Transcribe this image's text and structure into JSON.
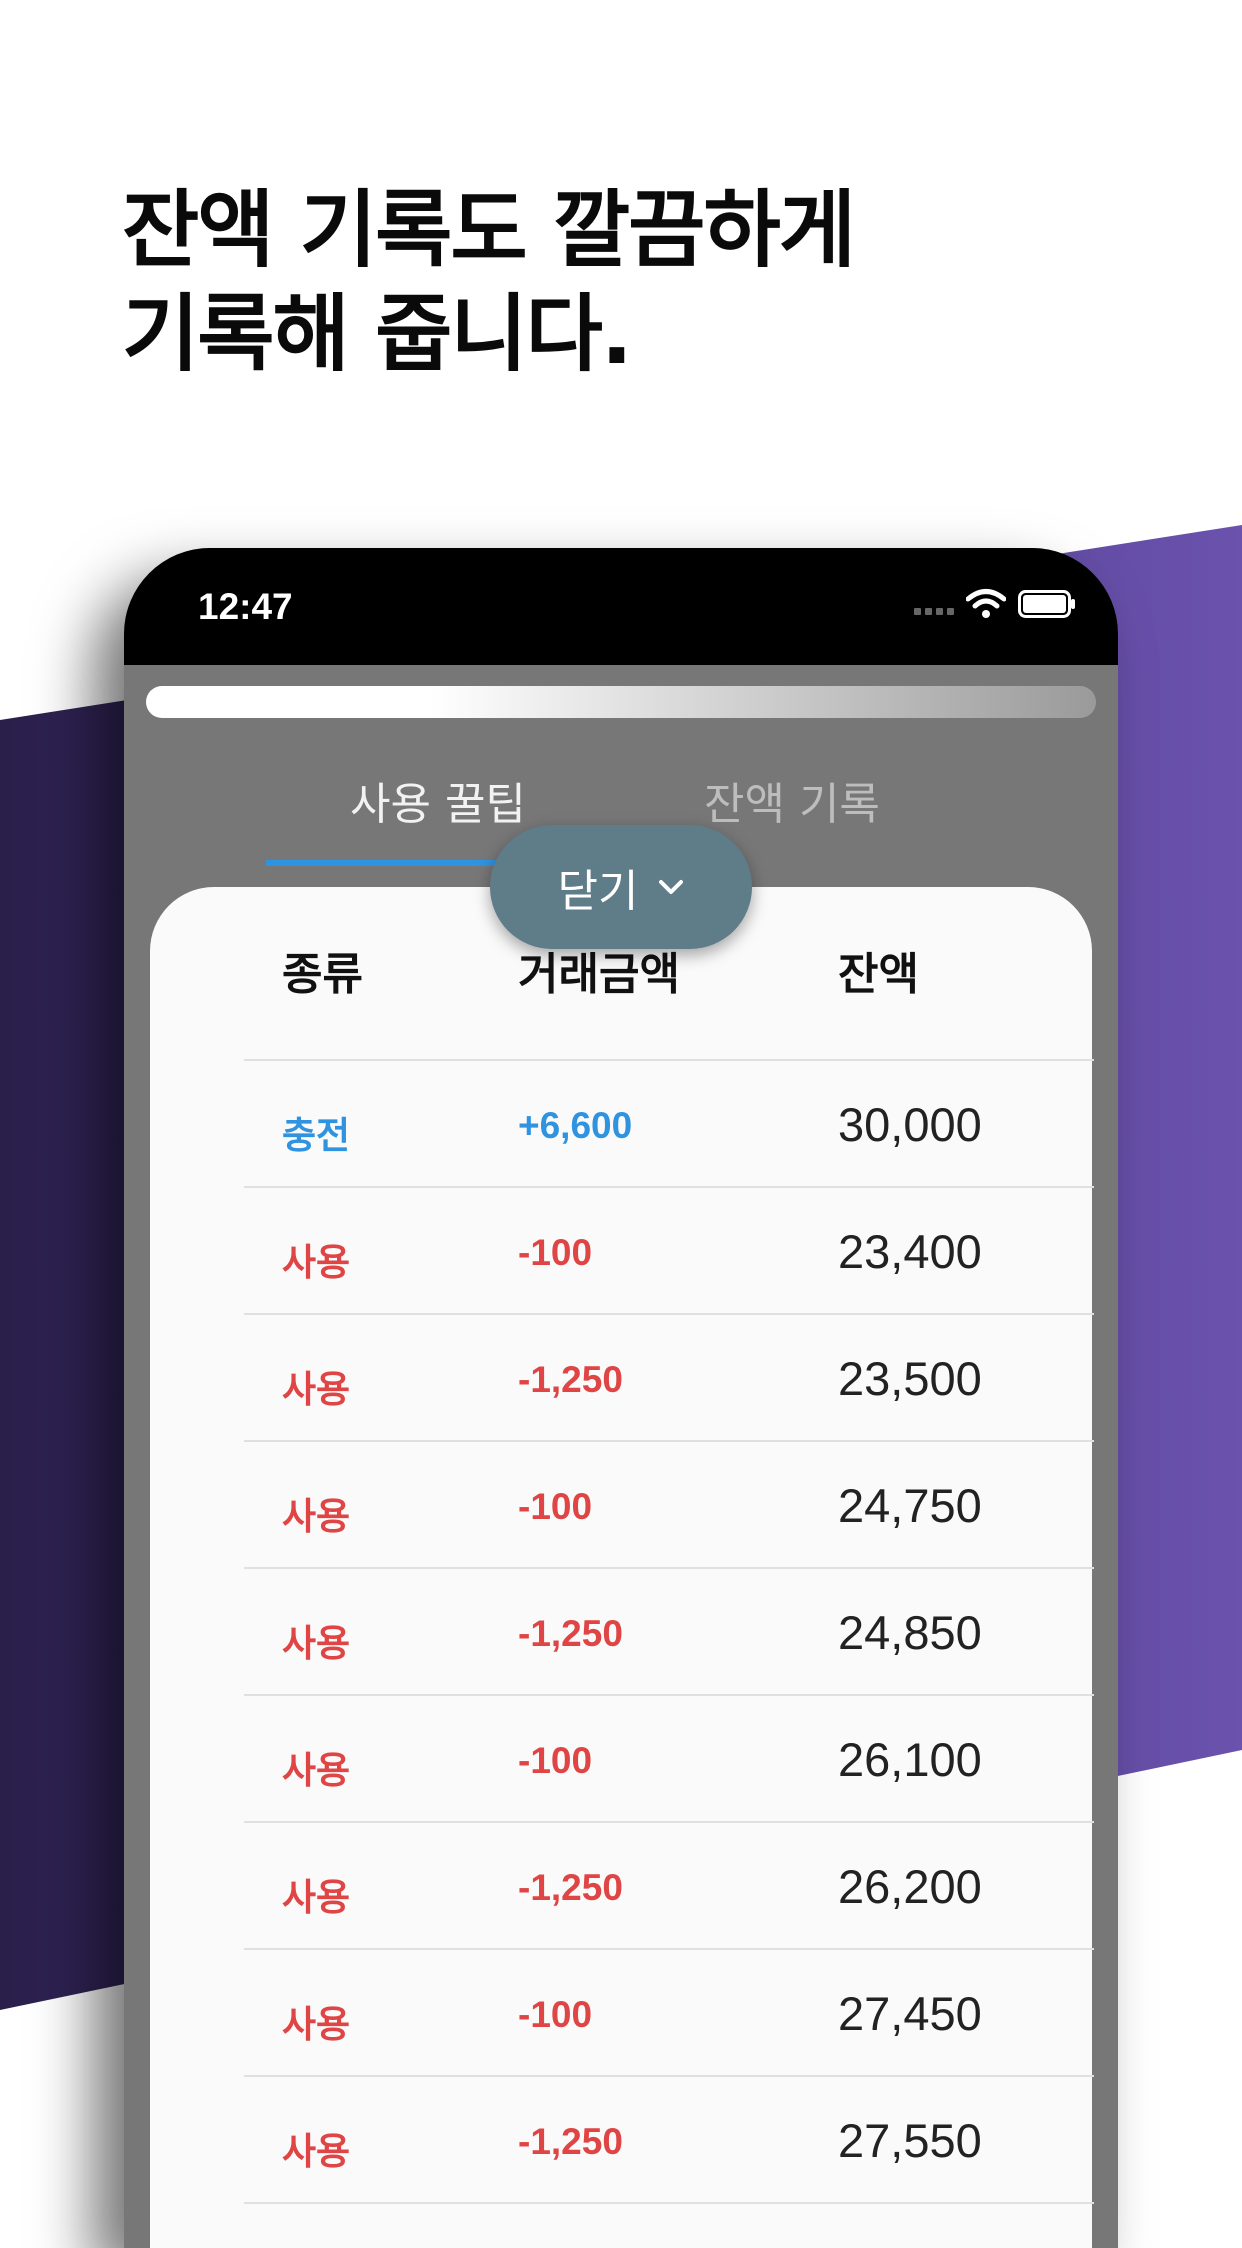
{
  "headline": {
    "line1": "잔액 기록도 깔끔하게",
    "line2": "기록해 줍니다."
  },
  "status_bar": {
    "time": "12:47",
    "icons": [
      "signal-icon",
      "wifi-icon",
      "battery-icon"
    ]
  },
  "tabs": [
    {
      "label": "사용 꿀팁",
      "active": true
    },
    {
      "label": "잔액 기록",
      "active": false
    }
  ],
  "close_button": {
    "label": "닫기",
    "icon": "chevron-down-icon"
  },
  "table": {
    "headers": [
      "종류",
      "거래금액",
      "잔액"
    ],
    "rows": [
      {
        "type": "충전",
        "amount": "+6,600",
        "balance": "30,000",
        "kind": "charge"
      },
      {
        "type": "사용",
        "amount": "-100",
        "balance": "23,400",
        "kind": "use"
      },
      {
        "type": "사용",
        "amount": "-1,250",
        "balance": "23,500",
        "kind": "use"
      },
      {
        "type": "사용",
        "amount": "-100",
        "balance": "24,750",
        "kind": "use"
      },
      {
        "type": "사용",
        "amount": "-1,250",
        "balance": "24,850",
        "kind": "use"
      },
      {
        "type": "사용",
        "amount": "-100",
        "balance": "26,100",
        "kind": "use"
      },
      {
        "type": "사용",
        "amount": "-1,250",
        "balance": "26,200",
        "kind": "use"
      },
      {
        "type": "사용",
        "amount": "-100",
        "balance": "27,450",
        "kind": "use"
      },
      {
        "type": "사용",
        "amount": "-1,250",
        "balance": "27,550",
        "kind": "use"
      }
    ]
  },
  "colors": {
    "charge": "#2f93e0",
    "use": "#e04545",
    "accent_purple": "#6a52ad",
    "close_button": "#5f7c89"
  }
}
